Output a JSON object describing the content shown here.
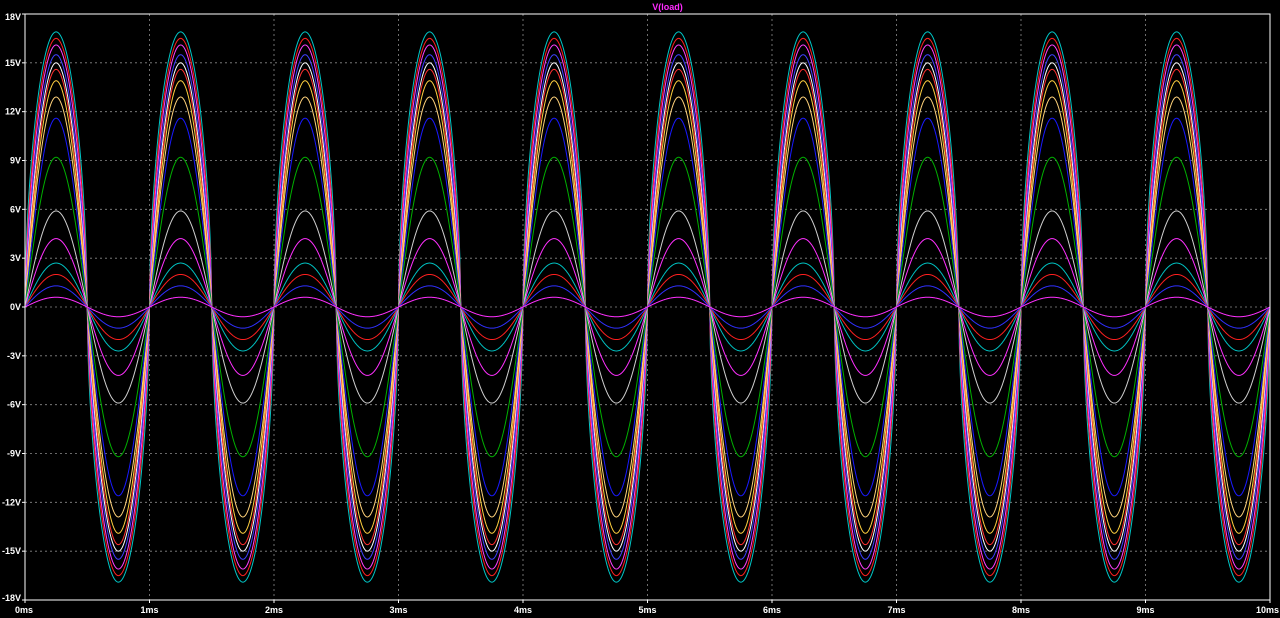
{
  "chart_data": {
    "type": "line",
    "title": "V(load)",
    "title_color": "#ff2bff",
    "background": "#000000",
    "grid": true,
    "grid_color": "#8a8a8a",
    "axis_color": "#ffffff",
    "xlim": [
      0,
      10
    ],
    "ylim": [
      -18,
      18
    ],
    "x_ticks": [
      0,
      1,
      2,
      3,
      4,
      5,
      6,
      7,
      8,
      9,
      10
    ],
    "x_tick_labels": [
      "0ms",
      "1ms",
      "2ms",
      "3ms",
      "4ms",
      "5ms",
      "6ms",
      "7ms",
      "8ms",
      "9ms",
      "10ms"
    ],
    "y_ticks": [
      18,
      15,
      12,
      9,
      6,
      3,
      0,
      -3,
      -6,
      -9,
      -12,
      -15,
      -18
    ],
    "y_tick_labels": [
      "18V",
      "15V",
      "12V",
      "9V",
      "6V",
      "3V",
      "0V",
      "-3V",
      "-6V",
      "-9V",
      "-12V",
      "-15V",
      "-18V"
    ],
    "waveform": "sine",
    "frequency_khz": 1,
    "series": [
      {
        "amplitude": 16.9,
        "shape": 0.55,
        "color": "#00c8c8"
      },
      {
        "amplitude": 16.5,
        "shape": 0.62,
        "color": "#ff2020"
      },
      {
        "amplitude": 16.1,
        "shape": 0.68,
        "color": "#ff40ff"
      },
      {
        "amplitude": 15.5,
        "shape": 0.75,
        "color": "#4040ff"
      },
      {
        "amplitude": 15.0,
        "shape": 0.82,
        "color": "#ffffff"
      },
      {
        "amplitude": 14.6,
        "shape": 0.88,
        "color": "#ff3030"
      },
      {
        "amplitude": 13.9,
        "shape": 0.92,
        "color": "#ffd040"
      },
      {
        "amplitude": 12.9,
        "shape": 0.95,
        "color": "#ffd27a"
      },
      {
        "amplitude": 11.6,
        "shape": 1.0,
        "color": "#1a1aff"
      },
      {
        "amplitude": 9.2,
        "shape": 1.0,
        "color": "#00b000"
      },
      {
        "amplitude": 5.9,
        "shape": 1.0,
        "color": "#d0d0d0"
      },
      {
        "amplitude": 4.2,
        "shape": 1.0,
        "color": "#ff30ff"
      },
      {
        "amplitude": 2.7,
        "shape": 1.0,
        "color": "#00c0c0"
      },
      {
        "amplitude": 2.0,
        "shape": 1.0,
        "color": "#ff2020"
      },
      {
        "amplitude": 1.3,
        "shape": 1.0,
        "color": "#3030ff"
      },
      {
        "amplitude": 0.6,
        "shape": 1.0,
        "color": "#ff30ff"
      }
    ]
  }
}
